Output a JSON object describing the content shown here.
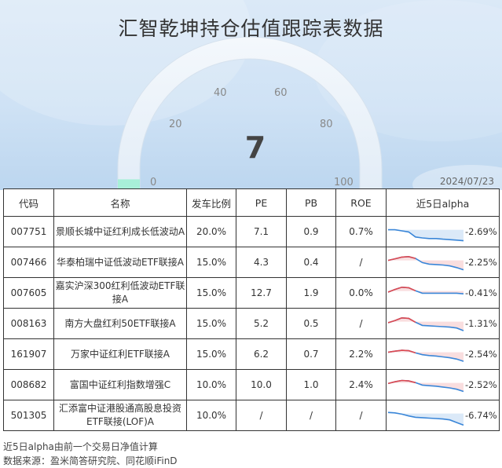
{
  "title": "汇智乾坤持仓估值跟踪表数据",
  "gauge": {
    "value": "7",
    "ticks": [
      "0",
      "20",
      "40",
      "60",
      "80",
      "100"
    ],
    "level_fraction": 0.07
  },
  "date": "2024/07/23",
  "table": {
    "headers": [
      "代码",
      "名称",
      "发车比例",
      "PE",
      "PB",
      "ROE",
      "近5日alpha"
    ],
    "rows": [
      {
        "code": "007751",
        "name": "景顺长城中证红利成长低波动A",
        "ratio": "20.0%",
        "pe": "7.1",
        "pb": "0.9",
        "roe": "0.7%",
        "alpha": "-2.69%"
      },
      {
        "code": "007466",
        "name": "华泰柏瑞中证低波动ETF联接A",
        "ratio": "15.0%",
        "pe": "4.3",
        "pb": "0.4",
        "roe": "/",
        "alpha": "-2.25%"
      },
      {
        "code": "007605",
        "name": "嘉实沪深300红利低波动ETF联接A",
        "ratio": "15.0%",
        "pe": "12.7",
        "pb": "1.9",
        "roe": "0.0%",
        "alpha": "-0.41%"
      },
      {
        "code": "008163",
        "name": "南方大盘红利50ETF联接A",
        "ratio": "15.0%",
        "pe": "5.2",
        "pb": "0.5",
        "roe": "/",
        "alpha": "-1.31%"
      },
      {
        "code": "161907",
        "name": "万家中证红利ETF联接A",
        "ratio": "15.0%",
        "pe": "6.2",
        "pb": "0.7",
        "roe": "2.2%",
        "alpha": "-2.54%"
      },
      {
        "code": "008682",
        "name": "富国中证红利指数增强C",
        "ratio": "10.0%",
        "pe": "10.0",
        "pb": "1.0",
        "roe": "2.4%",
        "alpha": "-2.52%"
      },
      {
        "code": "501305",
        "name": "汇添富中证港股通高股息投资ETF联接(LOF)A",
        "ratio": "10.0%",
        "pe": "/",
        "pb": "/",
        "roe": "/",
        "alpha": "-6.74%"
      }
    ]
  },
  "footnote": "近5日alpha由前一个交易日净值计算",
  "source": "数据来源：盈米简答研究院、同花顺iFinD",
  "colors": {
    "positive": "#e0494f",
    "negative": "#3a86d8",
    "gauge_fill": "#a8f0d8"
  }
}
